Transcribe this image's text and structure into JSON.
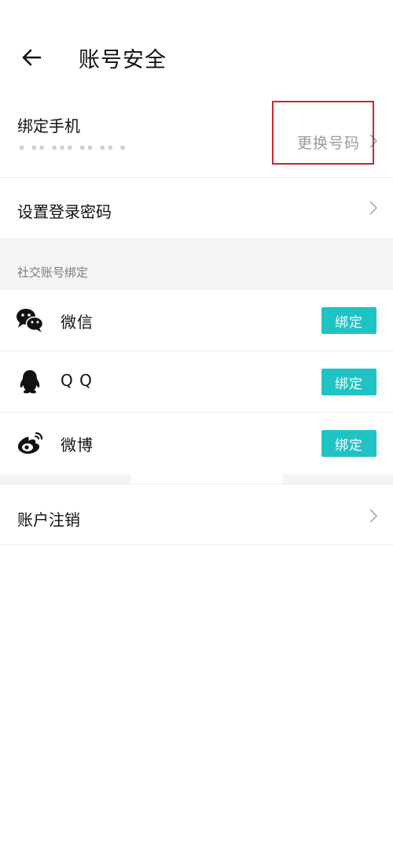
{
  "header": {
    "title": "账号安全",
    "back_icon": "arrow-left-icon"
  },
  "phone": {
    "label": "绑定手机",
    "masked_number": "▪ ▪▪ ▪▪▪ ▪▪ ▪▪ ▪",
    "change_label": "更换号码",
    "chevron_icon": "chevron-right-icon",
    "highlight_color": "#c3292f"
  },
  "password": {
    "label": "设置登录密码",
    "chevron_icon": "chevron-right-icon"
  },
  "social": {
    "section_title": "社交账号绑定",
    "items": [
      {
        "label": "微信",
        "icon": "wechat-icon",
        "button": "绑定"
      },
      {
        "label": "Q Q",
        "icon": "qq-icon",
        "button": "绑定"
      },
      {
        "label": "微博",
        "icon": "weibo-icon",
        "button": "绑定"
      }
    ],
    "button_color": "#20c3c3"
  },
  "deactivate": {
    "label": "账户注销",
    "chevron_icon": "chevron-right-icon"
  }
}
